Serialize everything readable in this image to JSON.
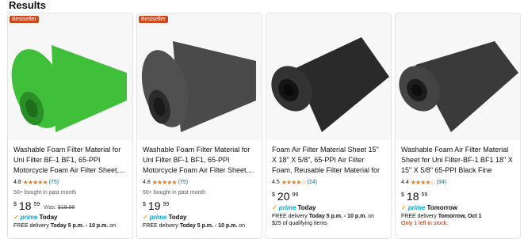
{
  "page": {
    "results_title": "Results"
  },
  "products": [
    {
      "badge": "Bestseller",
      "title": "Washable Foam Filter Material for Uni Filter BF-1 BF1, 65-PPI Motorcycle Foam Air Filter Sheet,...",
      "rating": "4.8",
      "stars": "★★★★★",
      "reviews": "(75)",
      "bought": "50+ bought in past month",
      "price_symbol": "$",
      "price_whole": "18",
      "price_fraction": "59",
      "was_label": "Was:",
      "was_price": "$19.99",
      "prime_day": "Today",
      "delivery_prefix": "FREE delivery ",
      "delivery_when": "Today 5 p.m. - 10 p.m.",
      "delivery_suffix": " on",
      "extra": "",
      "foam_color": "#3fbf3a",
      "foam_dark": "#2a8f27"
    },
    {
      "badge": "Bestseller",
      "title": "Washable Foam Filter Material for Uni Filter BF-1 BF1, 65-PPI Motorcycle Foam Air Filter Sheet,...",
      "rating": "4.8",
      "stars": "★★★★★",
      "reviews": "(75)",
      "bought": "50+ bought in past month",
      "price_symbol": "$",
      "price_whole": "19",
      "price_fraction": "99",
      "was_label": "",
      "was_price": "",
      "prime_day": "Today",
      "delivery_prefix": "FREE delivery ",
      "delivery_when": "Today 5 p.m. - 10 p.m.",
      "delivery_suffix": " on",
      "extra": "",
      "foam_color": "#4a4a4a",
      "foam_dark": "#2b2b2b"
    },
    {
      "badge": "",
      "title": "Foam Air Filter Material Sheet 15\" X 18\" X 5/8\", 65-PPI Air Filter Foam, Reusable Filter Material for Most...",
      "rating": "4.5",
      "stars": "★★★★☆",
      "reviews": "(24)",
      "bought": "",
      "price_symbol": "$",
      "price_whole": "20",
      "price_fraction": "99",
      "was_label": "",
      "was_price": "",
      "prime_day": "Today",
      "delivery_prefix": "FREE delivery ",
      "delivery_when": "Today 5 p.m. - 10 p.m.",
      "delivery_suffix": " on",
      "extra": "$25 of qualifying items",
      "foam_color": "#2a2a2a",
      "foam_dark": "#141414"
    },
    {
      "badge": "",
      "title": "Washable Foam Air Filter Material Sheet for Uni Filter-BF-1 BF1 18\" X 15\" X 5/8\" 65-PPI Black Fine Filter...",
      "rating": "4.4",
      "stars": "★★★★☆",
      "reviews": "(34)",
      "bought": "",
      "price_symbol": "$",
      "price_whole": "18",
      "price_fraction": "59",
      "was_label": "",
      "was_price": "",
      "prime_day": "Tomorrow",
      "delivery_prefix": "FREE delivery ",
      "delivery_when": "Tomorrow, Oct 1",
      "delivery_suffix": "",
      "extra": "Only 1 left in stock.",
      "foam_color": "#3a3a3a",
      "foam_dark": "#1c1c1c"
    }
  ],
  "prime_word": "prime"
}
